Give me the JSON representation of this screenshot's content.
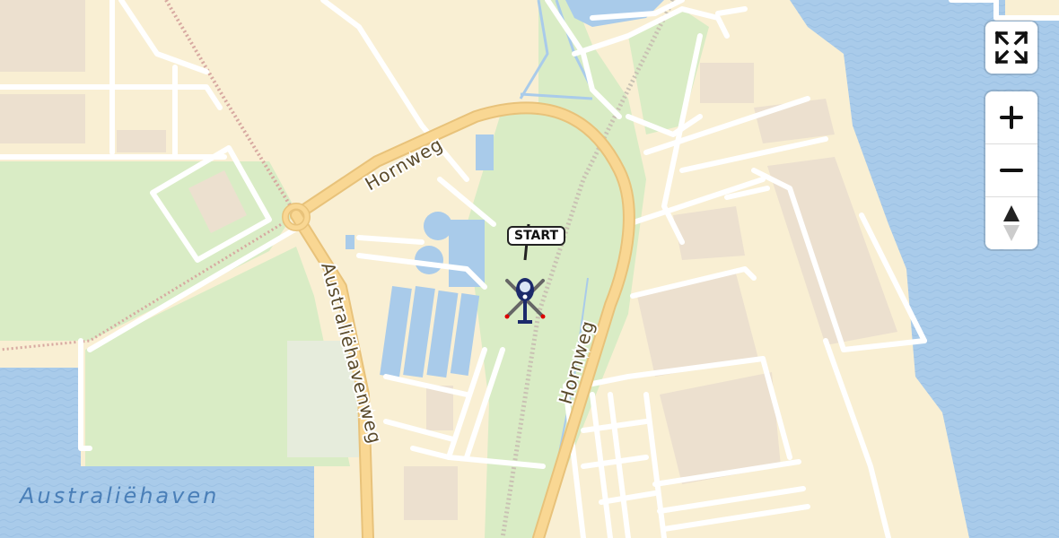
{
  "map": {
    "road_labels": {
      "hornweg_north": "Hornweg",
      "hornweg_east": "Hornweg",
      "australiehavenweg": "Australiëhavenweg"
    },
    "water_label": "Australiëhaven",
    "marker": {
      "label": "START",
      "icon": "helicopter-icon"
    },
    "colors": {
      "land": "#f9efd3",
      "park": "#d9ecc5",
      "water": "#a9cbea",
      "building": "#ece0cf",
      "road_major": "#f7d38a",
      "road_minor": "#ffffff"
    }
  },
  "controls": {
    "fullscreen": "fullscreen-icon",
    "zoom_in": "zoom-in-icon",
    "zoom_out": "zoom-out-icon",
    "compass": "compass-icon"
  }
}
